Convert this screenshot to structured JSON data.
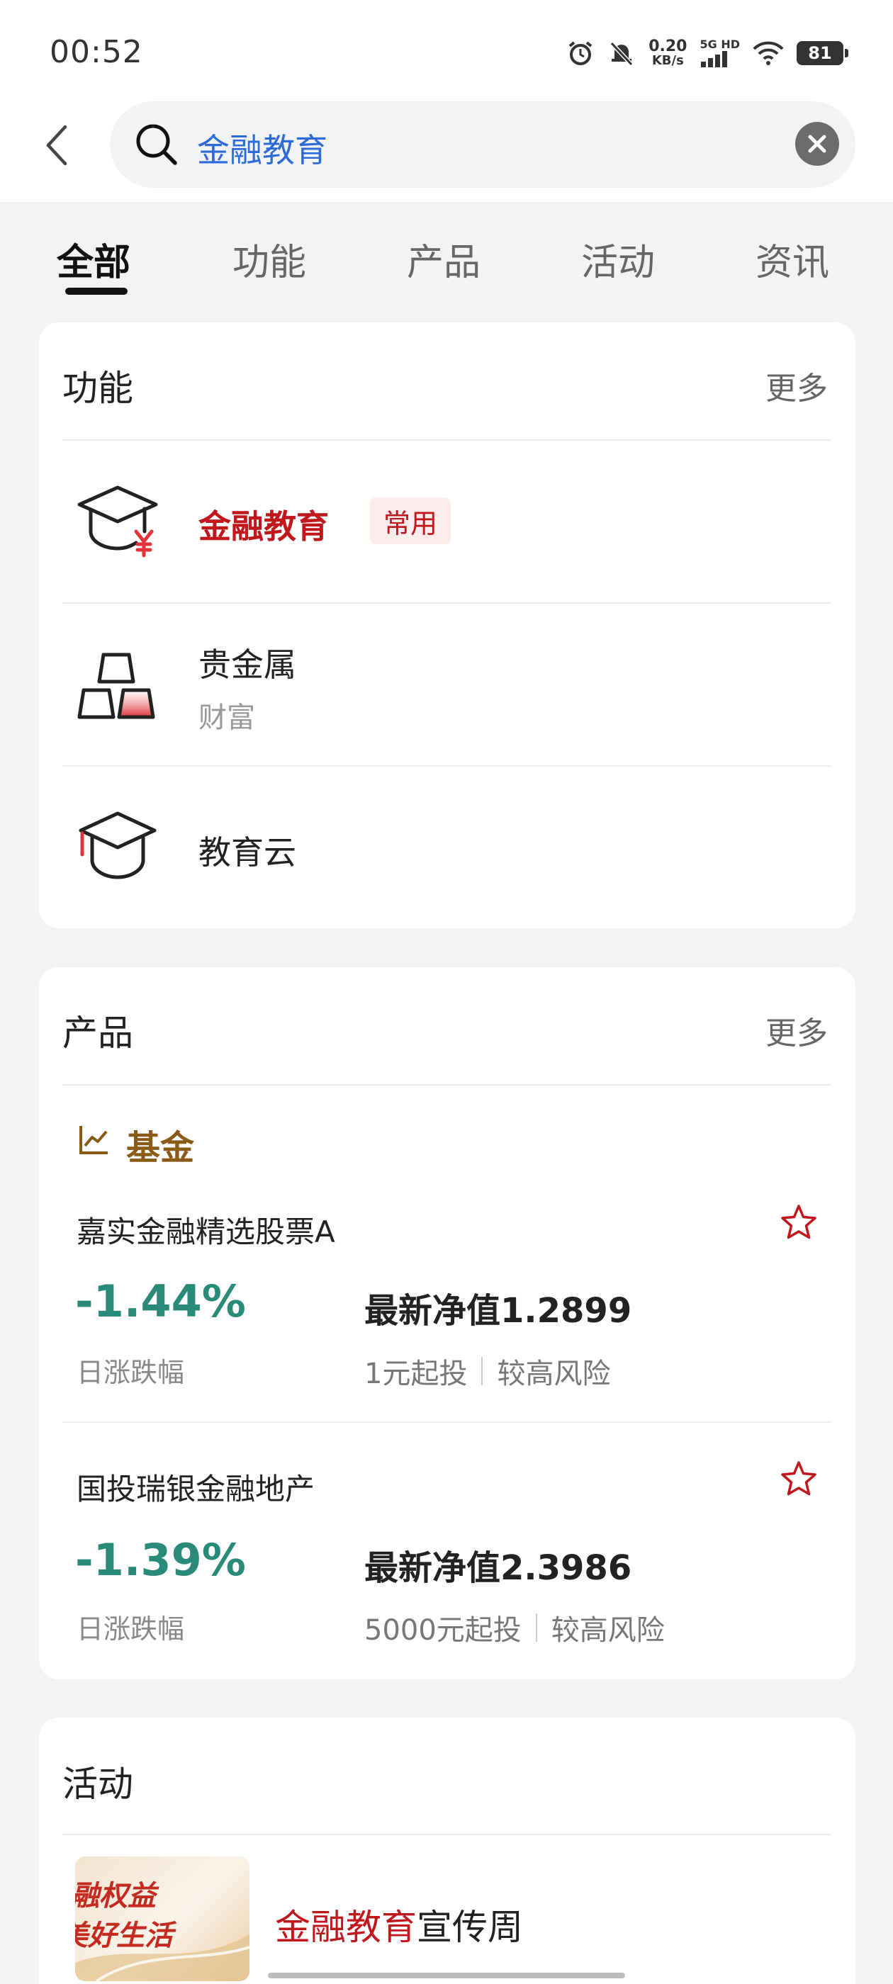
{
  "status_bar": {
    "time": "00:52",
    "net_speed_value": "0.20",
    "net_speed_unit": "KB/s",
    "signal_label": "5G HD",
    "battery": "81"
  },
  "search": {
    "query": "金融教育"
  },
  "tabs": [
    {
      "label": "全部",
      "active": true
    },
    {
      "label": "功能",
      "active": false
    },
    {
      "label": "产品",
      "active": false
    },
    {
      "label": "活动",
      "active": false
    },
    {
      "label": "资讯",
      "active": false
    }
  ],
  "functions": {
    "title": "功能",
    "more": "更多",
    "items": [
      {
        "name": "金融教育",
        "tag": "常用",
        "icon": "graduation-cap-yen-icon"
      },
      {
        "name": "贵金属",
        "subtitle": "财富",
        "icon": "gold-bars-icon"
      },
      {
        "name": "教育云",
        "icon": "graduation-cap-icon"
      }
    ]
  },
  "products": {
    "title": "产品",
    "more": "更多",
    "category": "基金",
    "funds": [
      {
        "name": "嘉实金融精选股票A",
        "change": "-1.44%",
        "change_label": "日涨跌幅",
        "nav": "最新净值1.2899",
        "min_invest": "1元起投",
        "risk": "较高风险"
      },
      {
        "name": "国投瑞银金融地产",
        "change": "-1.39%",
        "change_label": "日涨跌幅",
        "nav": "最新净值2.3986",
        "min_invest": "5000元起投",
        "risk": "较高风险"
      }
    ]
  },
  "activities": {
    "title": "活动",
    "items": [
      {
        "thumb_line1": "融权益",
        "thumb_line2": "美好生活",
        "title_highlight": "金融教育",
        "title_rest": "宣传周"
      }
    ]
  },
  "colors": {
    "accent_red": "#c0171d",
    "fund_green": "#2a8a7a",
    "search_blue": "#2c6bd8",
    "fund_brown": "#8a5a17"
  }
}
